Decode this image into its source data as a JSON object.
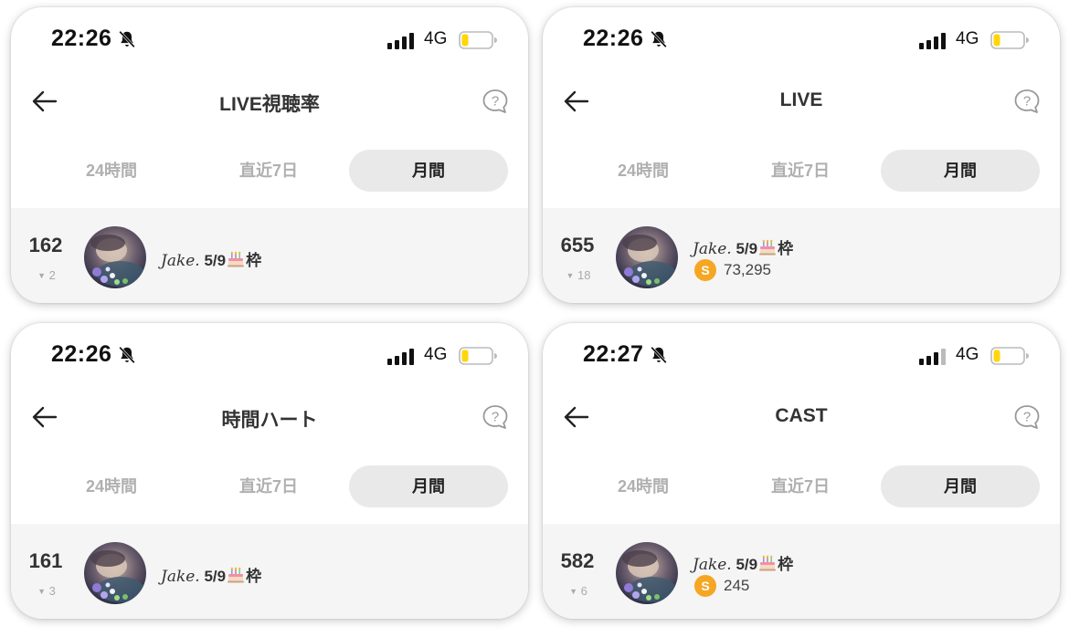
{
  "screens": [
    {
      "time": "22:26",
      "network": "4G",
      "title": "LIVE視聴率",
      "tabs": [
        "24時間",
        "直近7日",
        "月間"
      ],
      "selected_tab": "月間",
      "entry": {
        "rank": "162",
        "rank_change": "2",
        "name": "Jake.",
        "tag_prefix": "5/9",
        "tag_suffix": "枠",
        "coins": null
      }
    },
    {
      "time": "22:26",
      "network": "4G",
      "title": "LIVE",
      "tabs": [
        "24時間",
        "直近7日",
        "月間"
      ],
      "selected_tab": "月間",
      "entry": {
        "rank": "655",
        "rank_change": "18",
        "name": "Jake.",
        "tag_prefix": "5/9",
        "tag_suffix": "枠",
        "coins": "73,295"
      }
    },
    {
      "time": "22:26",
      "network": "4G",
      "title": "時間ハート",
      "tabs": [
        "24時間",
        "直近7日",
        "月間"
      ],
      "selected_tab": "月間",
      "entry": {
        "rank": "161",
        "rank_change": "3",
        "name": "Jake.",
        "tag_prefix": "5/9",
        "tag_suffix": "枠",
        "coins": null
      }
    },
    {
      "time": "22:27",
      "network": "4G",
      "title": "CAST",
      "tabs": [
        "24時間",
        "直近7日",
        "月間"
      ],
      "selected_tab": "月間",
      "entry": {
        "rank": "582",
        "rank_change": "6",
        "name": "Jake.",
        "tag_prefix": "5/9",
        "tag_suffix": "枠",
        "coins": "245"
      }
    }
  ],
  "icons": {
    "bell": "bell-slash-icon",
    "signal": "cellular-signal-icon",
    "battery": "battery-low-icon",
    "back": "arrow-left-icon",
    "help": "question-bubble-icon",
    "rank_change": "triangle-down-icon",
    "coin": "coin-s-icon",
    "cake": "birthday-cake-icon"
  },
  "colors": {
    "coin": "#f5a623",
    "battery_fill": "#ffd60a",
    "selected_tab_bg": "#e9e9e9",
    "row_bg": "#f5f5f5",
    "inactive_tab": "#b0b0b0"
  }
}
